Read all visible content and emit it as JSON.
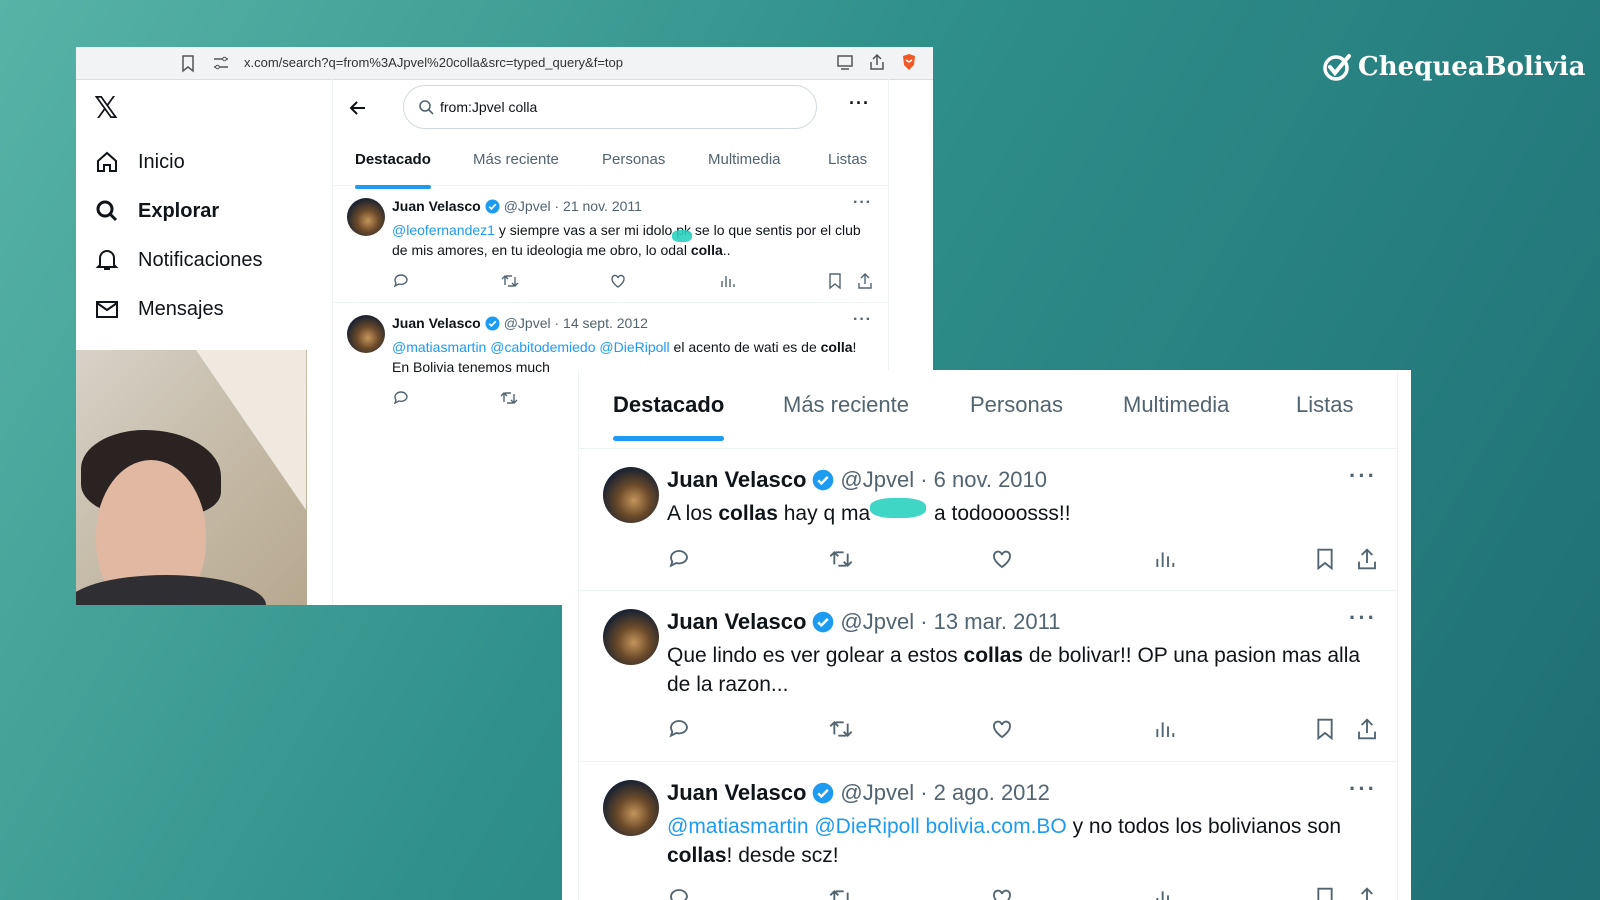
{
  "brand": {
    "name": "ChequeaBolivia",
    "icon": "check-circle-icon"
  },
  "browser": {
    "url": "x.com/search?q=from%3AJpvel%20colla&src=typed_query&f=top"
  },
  "sidebar": {
    "items": [
      {
        "label": "Inicio",
        "icon": "home-icon"
      },
      {
        "label": "Explorar",
        "icon": "search-icon"
      },
      {
        "label": "Notificaciones",
        "icon": "bell-icon"
      },
      {
        "label": "Mensajes",
        "icon": "mail-icon"
      }
    ]
  },
  "search": {
    "query": "from:Jpvel colla"
  },
  "tabs": [
    "Destacado",
    "Más reciente",
    "Personas",
    "Multimedia",
    "Listas"
  ],
  "tweets_top": [
    {
      "name": "Juan Velasco",
      "meta": "@Jpvel · 21 nov. 2011",
      "mention": "@leofernandez1",
      "text_a": " y siempre vas a ser mi idolo pk se lo que sentis por el club de mis amores, en tu ideologia me obro, lo od",
      "text_b": "al ",
      "bold": "colla",
      "text_c": ".."
    },
    {
      "name": "Juan Velasco",
      "meta": "@Jpvel · 14 sept. 2012",
      "mention": "@matiasmartin @cabitodemiedo @DieRipoll",
      "text_a": " el acento de wati es de ",
      "bold": "colla",
      "text_c": "!",
      "line2": "En Bolivia tenemos much"
    }
  ],
  "tweets_zoom": [
    {
      "name": "Juan Velasco",
      "meta": "@Jpvel · 6 nov. 2010",
      "text_a": "A los ",
      "bold": "collas",
      "text_b": " hay q ma",
      "text_c": " a todoooosss!!"
    },
    {
      "name": "Juan Velasco",
      "meta": "@Jpvel · 13 mar. 2011",
      "text_a": "Que lindo es ver golear a estos ",
      "bold": "collas",
      "text_b": " de bolivar!! OP una pasion mas alla de la razon..."
    },
    {
      "name": "Juan Velasco",
      "meta": "@Jpvel · 2 ago. 2012",
      "mention": "@matiasmartin @DieRipoll bolivia.com.BO",
      "text_a": " y no todos los bolivianos son ",
      "bold": "collas",
      "text_b": "! desde scz!"
    }
  ],
  "colors": {
    "accent": "#1d9bf0",
    "background": "#2f8f8a",
    "scribble": "#2ad1c0"
  }
}
